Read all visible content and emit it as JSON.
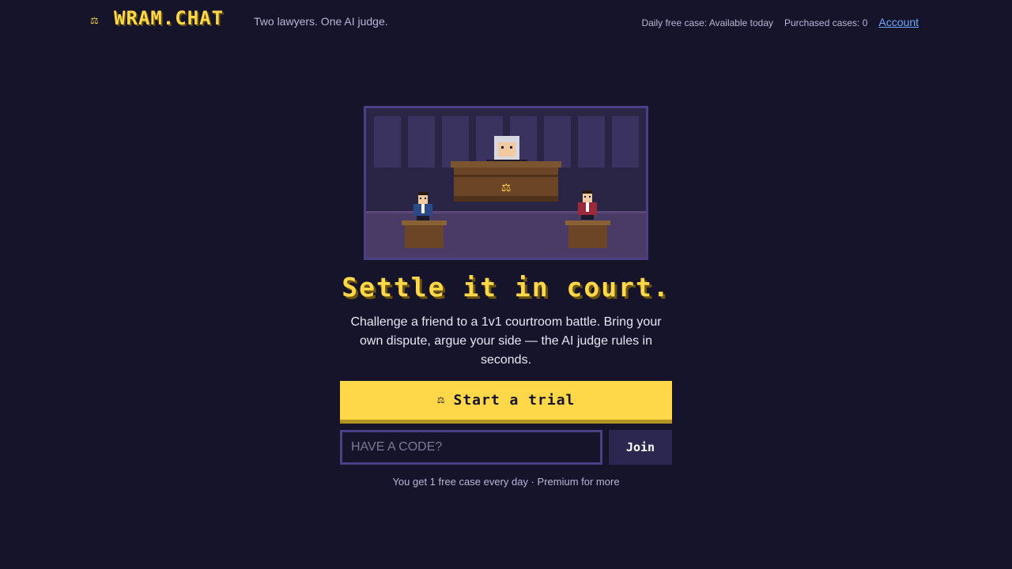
{
  "header": {
    "logo_icon": "⚖",
    "logo_text": "WRAM.CHAT",
    "tagline": "Two lawyers. One AI judge.",
    "daily_case": "Daily free case: Available today",
    "purchased_cases": "Purchased cases: 0",
    "account_link": "Account"
  },
  "scene": {
    "alt": "Pixel-art courtroom with a judge at the bench and two lawyers at their desks"
  },
  "hero": {
    "headline": "Settle it in court.",
    "description": "Challenge a friend to a 1v1 courtroom battle. Bring your own dispute, argue your side — the AI judge rules in seconds."
  },
  "actions": {
    "start_icon": "⚖",
    "start_label": "Start a trial",
    "code_placeholder": "HAVE A CODE?",
    "code_value": "",
    "join_label": "Join"
  },
  "footer": {
    "note": "You get 1 free case every day · Premium for more"
  },
  "colors": {
    "background": "#16142a",
    "accent": "#ffd84a",
    "frame": "#4b3f86",
    "link": "#6fa8ff"
  }
}
